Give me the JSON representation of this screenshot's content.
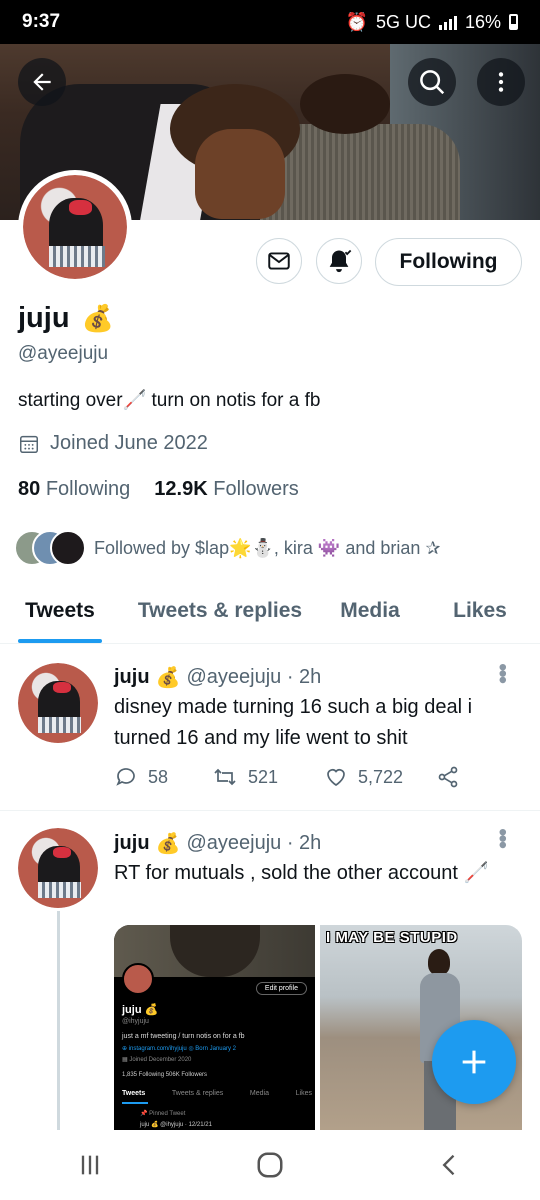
{
  "status_bar": {
    "time": "9:37",
    "network": "5G UC",
    "battery": "16%"
  },
  "profile": {
    "name": "juju",
    "name_emoji": "💰",
    "handle": "@ayeejuju",
    "bio": "starting over🦯 turn on notis for a fb",
    "joined": "Joined June 2022",
    "following_count": "80",
    "following_label": "Following",
    "followers_count": "12.9K",
    "followers_label": "Followers",
    "followed_by": "Followed by $lap🌟⛄, kira 👾 and brian ✰",
    "follow_button": "Following"
  },
  "tabs": [
    "Tweets",
    "Tweets & replies",
    "Media",
    "Likes"
  ],
  "tweets": [
    {
      "name": "juju",
      "emoji": "💰",
      "handle_time": "@ayeejuju · 2h",
      "text": "disney made turning 16 such a big deal i turned 16 and my life went to shit",
      "replies": "58",
      "retweets": "521",
      "likes": "5,722"
    },
    {
      "name": "juju",
      "emoji": "💰",
      "handle_time": "@ayeejuju · 2h",
      "text": "RT for mutuals , sold the other account 🦯",
      "embedded": {
        "edit_profile": "Edit profile",
        "name": "juju 💰",
        "handle": "@ihyjuju",
        "bio": "just a mf tweeting / turn notis on for a fb",
        "links": "⊕ instagram.com/ihyjuju  ◎ Born January 2",
        "joined": "▦ Joined December 2020",
        "counts": "1,835 Following  506K Followers",
        "tabs": [
          "Tweets",
          "Tweets & replies",
          "Media",
          "Likes"
        ],
        "pinned": "📌 Pinned Tweet",
        "pinned_author": "juju 💰 @ihyjuju · 12/21/21"
      },
      "meme_text": "I MAY BE STUPID"
    }
  ],
  "colors": {
    "accent": "#1d9bf0",
    "text": "#0f1419",
    "muted": "#536471",
    "border": "#cfd9de"
  }
}
